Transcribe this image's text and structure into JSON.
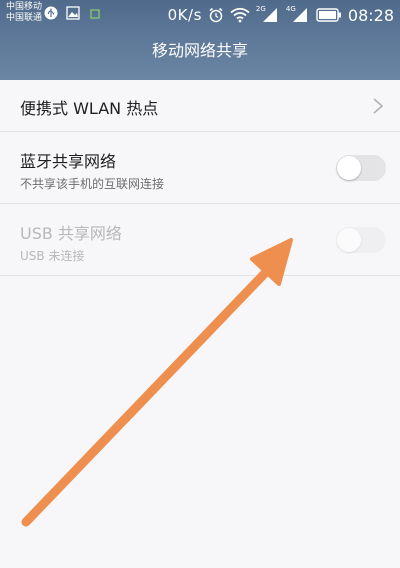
{
  "status_bar": {
    "carrier_1": "中国移动",
    "carrier_2": "中国联通",
    "net_speed": "0K/s",
    "network_2g": "2G",
    "network_4g": "4G",
    "time": "08:28"
  },
  "header": {
    "title": "移动网络共享"
  },
  "settings": {
    "hotspot": {
      "label": "便携式 WLAN 热点"
    },
    "bluetooth": {
      "label": "蓝牙共享网络",
      "description": "不共享该手机的互联网连接",
      "enabled": false
    },
    "usb": {
      "label": "USB 共享网络",
      "description": "USB 未连接",
      "enabled": false,
      "disabled": true
    }
  },
  "colors": {
    "header": "#5d7898",
    "arrow": "#ee8f4f",
    "background": "#f7f6f8"
  },
  "icons": {
    "status": [
      "usb-icon",
      "image-icon",
      "sim-icon",
      "alarm-icon",
      "wifi-icon",
      "signal-icon",
      "battery-icon"
    ],
    "annotation": "arrow-icon"
  }
}
